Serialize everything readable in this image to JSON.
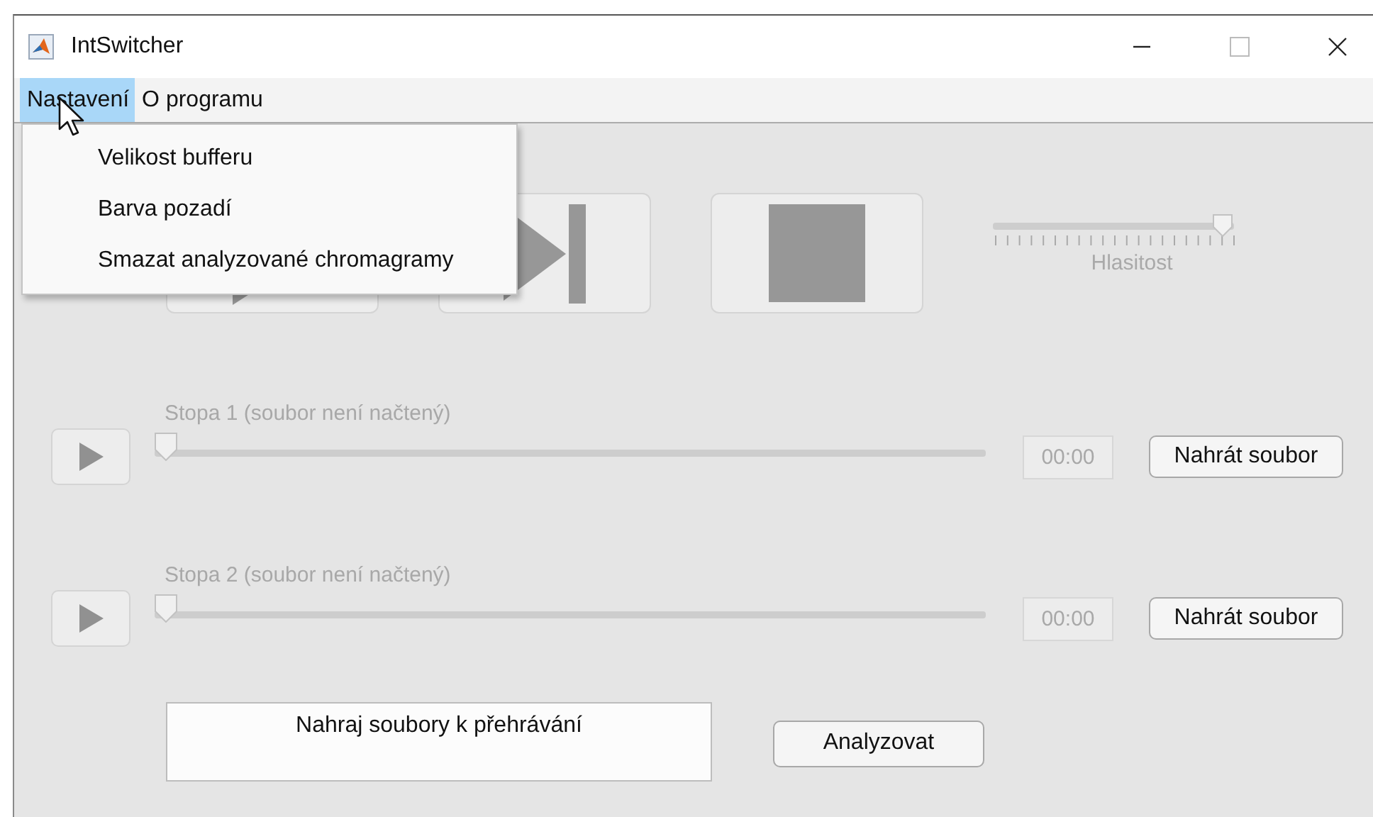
{
  "window": {
    "title": "IntSwitcher"
  },
  "menu": [
    {
      "label": "Nastavení",
      "selected": true
    },
    {
      "label": "O programu",
      "selected": false
    }
  ],
  "dropdown": [
    {
      "label": "Velikost bufferu"
    },
    {
      "label": "Barva pozadí"
    },
    {
      "label": "Smazat analyzované chromagramy"
    }
  ],
  "transport": [
    {
      "kind": "play"
    },
    {
      "kind": "next"
    },
    {
      "kind": "stop"
    }
  ],
  "volume": {
    "label": "Hlasitost",
    "level": 0.98
  },
  "tracks": [
    {
      "label": "Stopa 1 (soubor není načtený)",
      "level": 0,
      "time": "00:00",
      "button": "Nahrát soubor",
      "disabled": true
    },
    {
      "label": "Stopa 2 (soubor není načtený)",
      "level": 0,
      "time": "00:00",
      "button": "Nahrát soubor",
      "disabled": true
    }
  ],
  "status": "Nahraj soubory k přehrávání",
  "analyze_button": "Analyzovat"
}
